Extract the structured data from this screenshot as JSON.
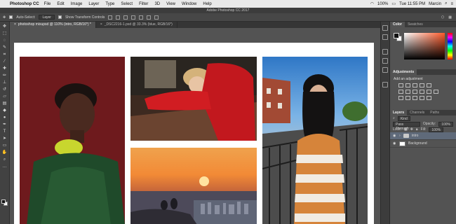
{
  "menubar": {
    "app_name": "Photoshop CC",
    "items": [
      "File",
      "Edit",
      "Image",
      "Layer",
      "Type",
      "Select",
      "Filter",
      "3D",
      "View",
      "Window",
      "Help"
    ],
    "battery": "100%",
    "clock": "Tue 11:55 PM",
    "user": "Marcin"
  },
  "window": {
    "title": "Adobe Photoshop CC 2017"
  },
  "options": {
    "auto_select_label": "Auto-Select:",
    "auto_select_value": "Layer",
    "transform_label": "Show Transform Controls"
  },
  "tabs": [
    {
      "label": "photoshop mixupsd @ 110% (intro, RGB/16*) *",
      "active": true
    },
    {
      "label": "_DSC2216-1.psd @ 33.3% (blue, RGB/16*)",
      "active": false
    }
  ],
  "panels": {
    "color_tab": "Color",
    "swatches_tab": "Swatches",
    "adjustments_title": "Adjustments",
    "adjustments_subtitle": "Add an adjustment",
    "layers_tab": "Layers",
    "channels_tab": "Channels",
    "paths_tab": "Paths",
    "kind_label": "Kind",
    "blend_mode": "Pass Through",
    "opacity_label": "Opacity:",
    "opacity_value": "100%",
    "lock_label": "Lock:",
    "fill_label": "Fill:",
    "fill_value": "100%",
    "layers": [
      {
        "name": "intro",
        "type": "folder",
        "selected": true
      },
      {
        "name": "Background",
        "type": "layer",
        "selected": false
      }
    ]
  },
  "colors": {
    "photo1_bg": "#6e1a1d",
    "photo2_bg": "#3d2a20",
    "selection": "#5f6a7a"
  }
}
